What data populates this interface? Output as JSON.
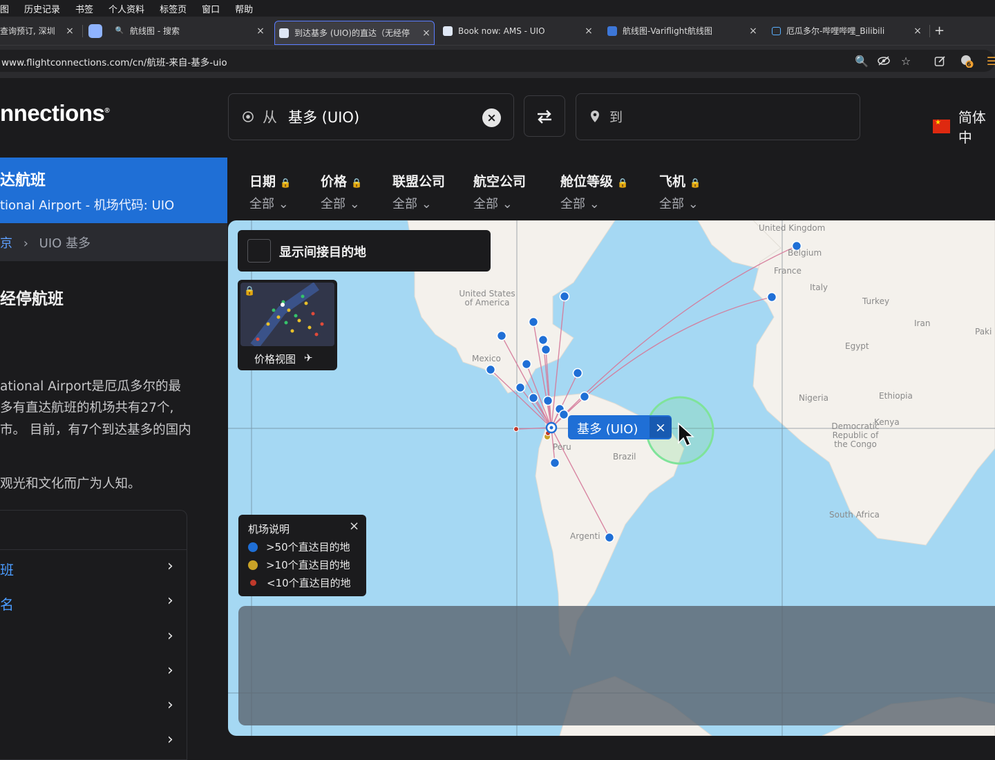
{
  "menubar": {
    "items": [
      "图",
      "历史记录",
      "书签",
      "个人资料",
      "标签页",
      "窗口",
      "帮助"
    ]
  },
  "tabs": [
    {
      "label": "查询预订, 深圳",
      "active": false
    },
    {
      "label": "",
      "active": false
    },
    {
      "label": "航线图 - 搜索",
      "active": false
    },
    {
      "label": "到达基多 (UIO)的直达（无经停",
      "active": true
    },
    {
      "label": "Book now: AMS - UIO",
      "active": false
    },
    {
      "label": "航线图-Variflight航线图",
      "active": false
    },
    {
      "label": "厄瓜多尔-哔哩哔哩_Bilibili",
      "active": false
    }
  ],
  "new_tab": "+",
  "close_glyph": "×",
  "url": "www.flightconnections.com/cn/航班-来自-基多-uio",
  "toolbar_badge": "6",
  "header": {
    "logo": "nnections",
    "from_prefix": "从",
    "from_value": "基多 (UIO)",
    "to_placeholder": "到",
    "language": "简体中"
  },
  "left": {
    "title": "达航班",
    "subtitle": "tional Airport - 机场代码: UIO",
    "breadcrumb_link": "京",
    "breadcrumb_current": "UIO 基多",
    "section_title": "经停航班",
    "description": [
      "ational Airport是厄瓜多尔的最",
      "多有直达航班的机场共有27个,",
      "市。 目前，有7个到达基多的国内",
      "观光和文化而广为人知。"
    ],
    "links": [
      "班",
      "名",
      "",
      "",
      "",
      ""
    ]
  },
  "filters": [
    {
      "label": "日期",
      "value": "全部",
      "locked": true
    },
    {
      "label": "价格",
      "value": "全部",
      "locked": true
    },
    {
      "label": "联盟公司",
      "value": "全部",
      "locked": false
    },
    {
      "label": "航空公司",
      "value": "全部",
      "locked": false
    },
    {
      "label": "舱位等级",
      "value": "全部",
      "locked": true
    },
    {
      "label": "飞机",
      "value": "全部",
      "locked": true
    }
  ],
  "map": {
    "indirect_label": "显示间接目的地",
    "price_view_label": "价格视图",
    "origin_label": "基多 (UIO)",
    "legend": {
      "title": "机场说明",
      "items": [
        {
          "label": ">50个直达目的地",
          "color": "#1f6fd6"
        },
        {
          "label": ">10个直达目的地",
          "color": "#c9a227"
        },
        {
          "label": "<10个直达目的地",
          "color": "#c0392b"
        }
      ]
    },
    "place_labels": [
      "United Kingdom",
      "Belgium",
      "France",
      "Italy",
      "Turkey",
      "Iran",
      "Paki",
      "Egypt",
      "United States of America",
      "Mexico",
      "Nigeria",
      "Ethiopia",
      "Kenya",
      "Democratic Republic of the Congo",
      "Peru",
      "Brazil",
      "South Africa",
      "Argenti"
    ]
  },
  "colors": {
    "accent": "#1f6fd6",
    "route": "#d57a9a",
    "sea": "#a5d8f3",
    "land": "#f4f1ec"
  }
}
